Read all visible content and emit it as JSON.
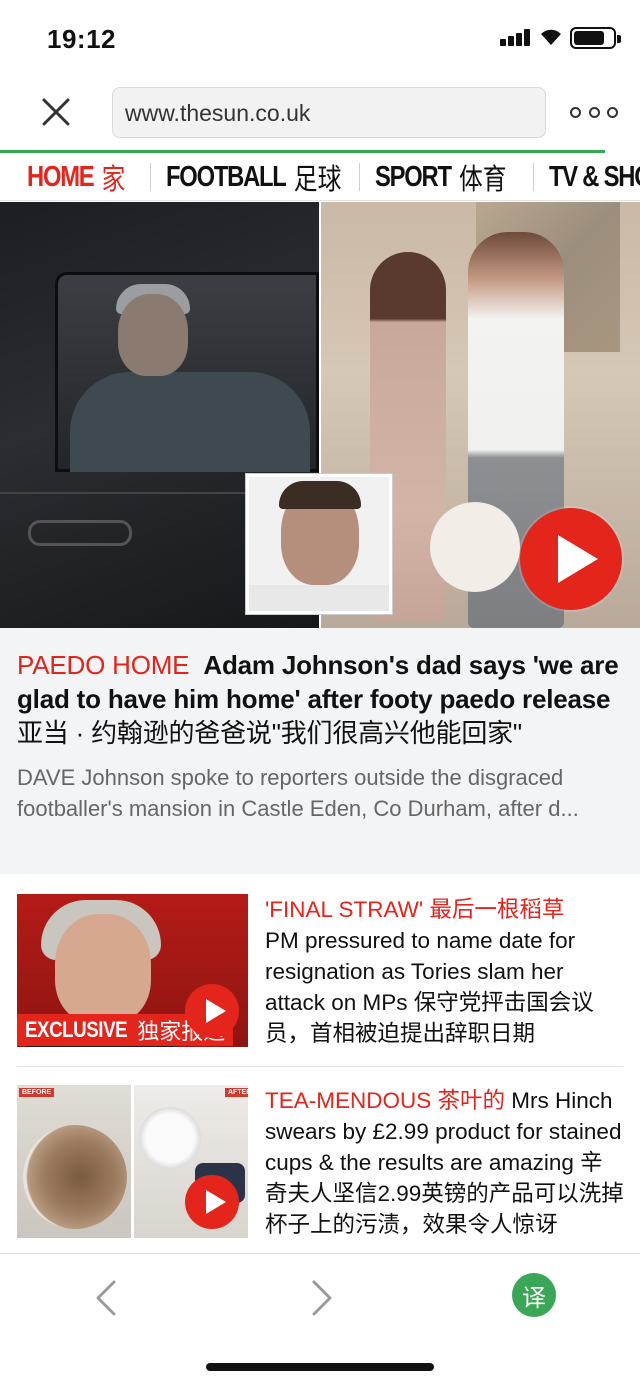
{
  "status_bar": {
    "time": "19:12"
  },
  "browser": {
    "url": "www.thesun.co.uk",
    "close_icon": "close-icon",
    "more_icon": "more-dots-icon"
  },
  "nav": {
    "items": [
      {
        "en": "HOME",
        "zh": "家",
        "active": true
      },
      {
        "en": "FOOTBALL",
        "zh": "足球",
        "active": false
      },
      {
        "en": "SPORT",
        "zh": "体育",
        "active": false
      },
      {
        "en": "TV & SHO",
        "zh": "",
        "active": false
      }
    ]
  },
  "hero": {
    "kicker": "PAEDO HOME",
    "headline": "Adam Johnson's dad says 'we are glad to have him home' after footy paedo release",
    "headline_zh": "亚当 · 约翰逊的爸爸说\"我们很高兴他能回家\"",
    "summary": "DAVE Johnson spoke to reporters outside the disgraced footballer's mansion in Castle Eden, Co Durham, after d..."
  },
  "stories": [
    {
      "kicker": "'FINAL STRAW' 最后一根稻草",
      "text": "PM pressured to name date for resignation as Tories slam her attack on MPs 保守党抨击国会议员，首相被迫提出辞职日期",
      "badge_en": "EXCLUSIVE",
      "badge_zh": "独家报道"
    },
    {
      "kicker": "TEA-MENDOUS 茶叶的",
      "text": "Mrs Hinch swears by £2.99 product for stained cups & the results are amazing 辛奇夫人坚信2.99英镑的产品可以洗掉杯子上的污渍，效果令人惊讶",
      "tag_before": "BEFORE",
      "tag_after": "AFTER"
    }
  ],
  "toolbar": {
    "translate_label": "译"
  },
  "colors": {
    "brand_red": "#e3251c",
    "progress_green": "#34a853",
    "translate_green": "#3aa657"
  }
}
